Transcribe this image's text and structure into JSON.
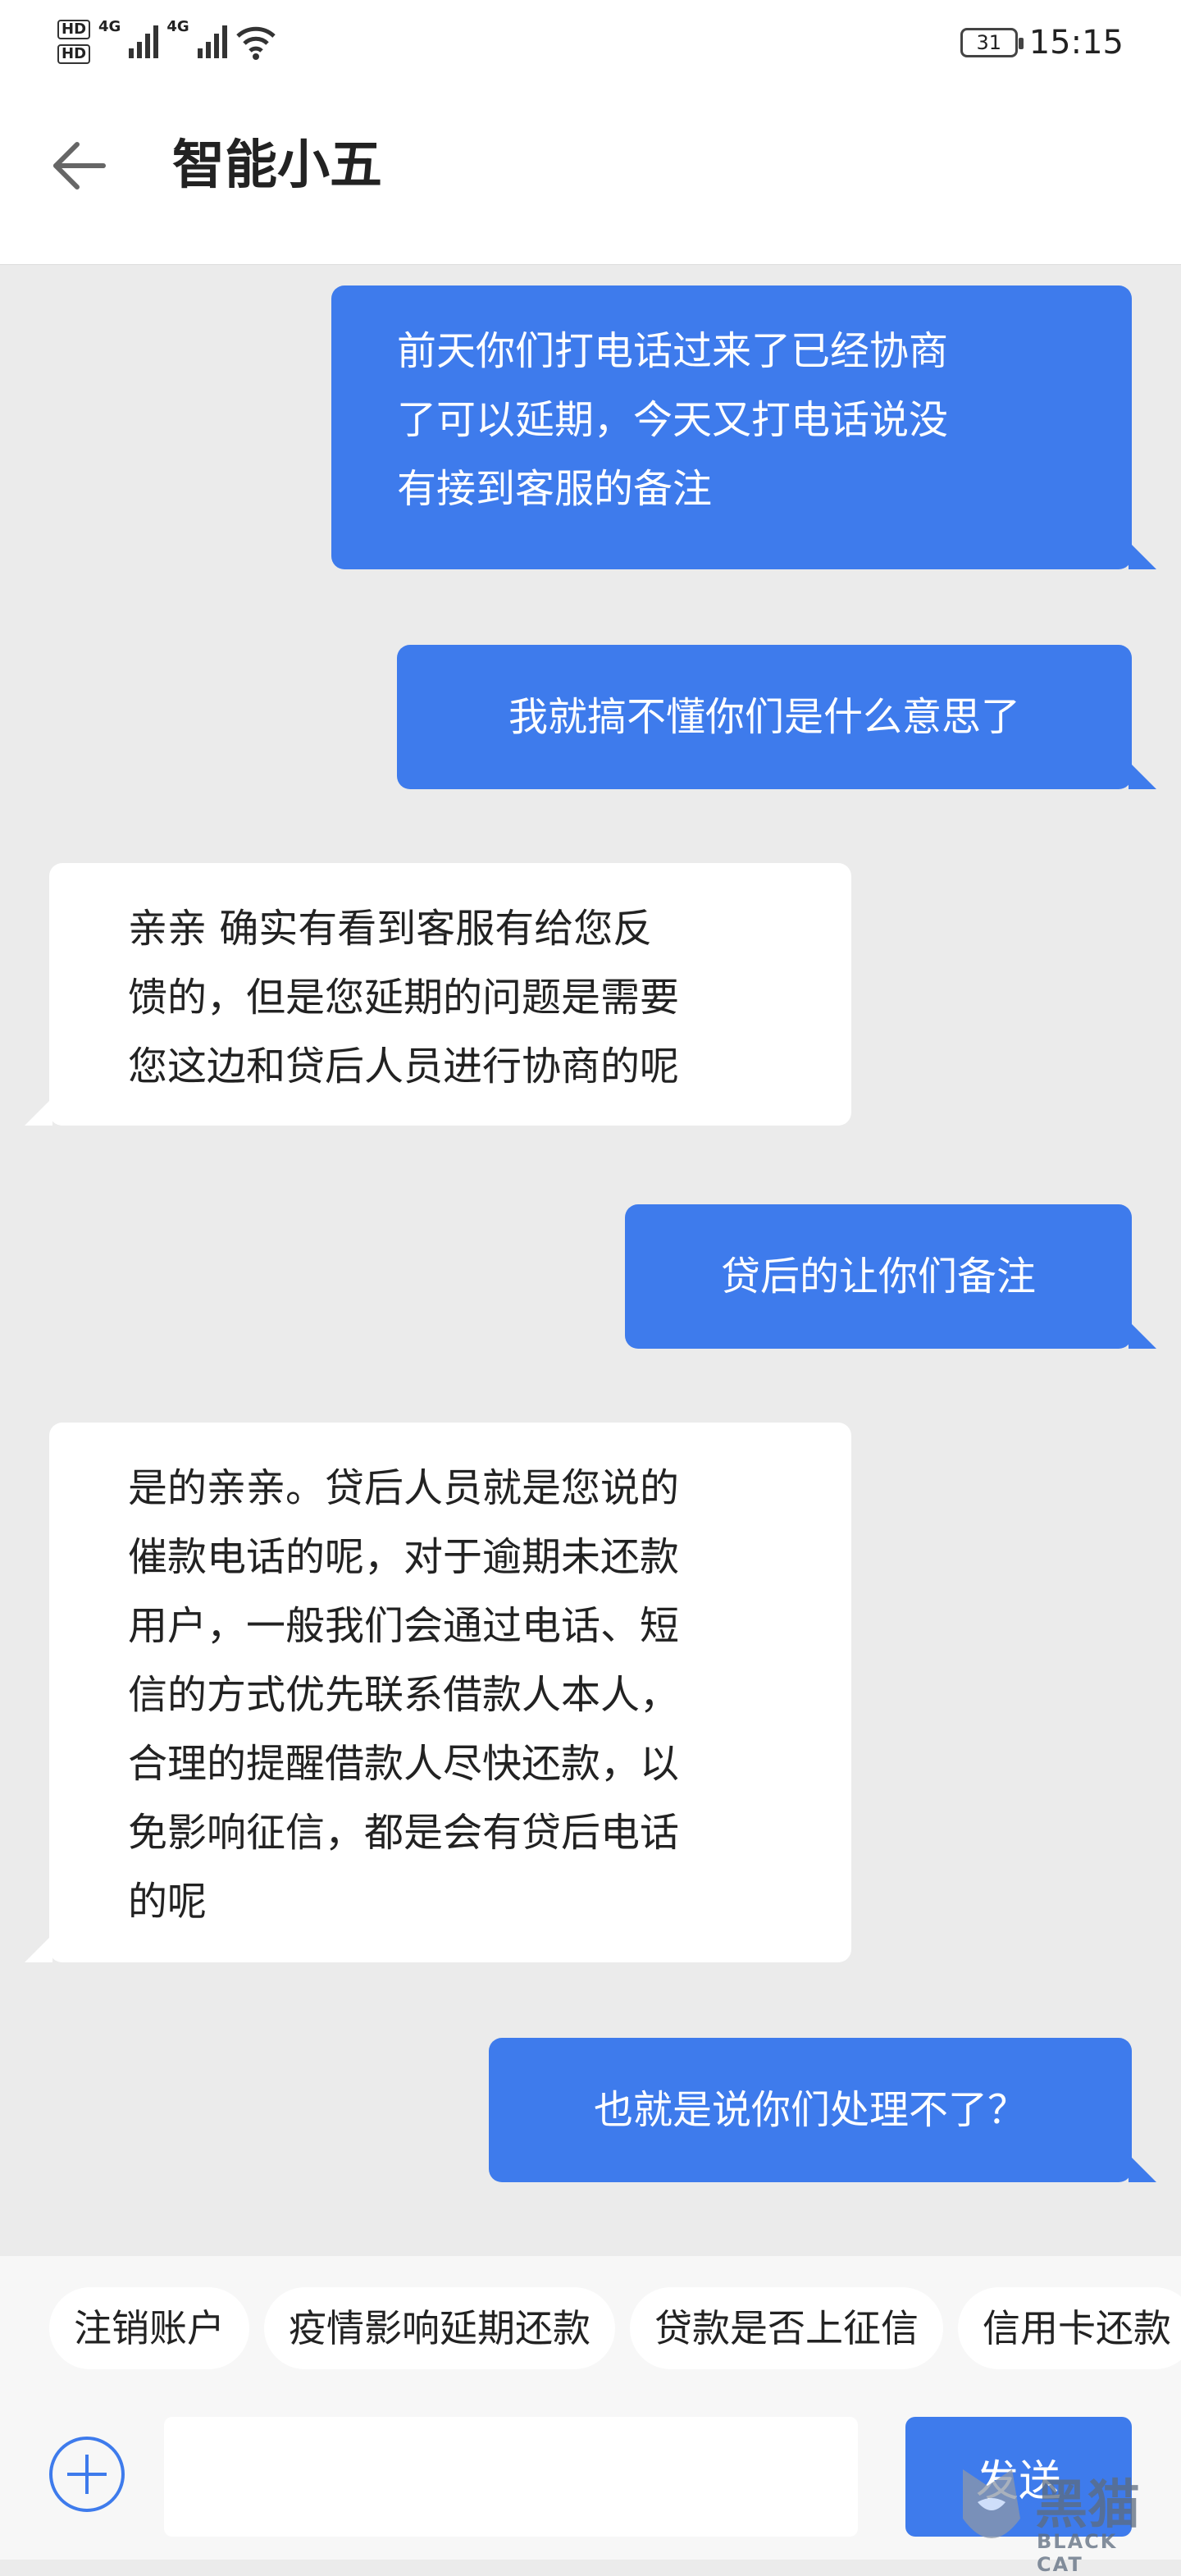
{
  "status_bar": {
    "hd1": "HD",
    "hd2": "HD",
    "net1": "4G",
    "net2": "4G",
    "battery": "31",
    "time": "15:15"
  },
  "header": {
    "title": "智能小五",
    "back_icon": "arrow-left-icon"
  },
  "messages": [
    {
      "side": "out",
      "lines": [
        "前天你们打电话过来了已经协商",
        "了可以延期，今天又打电话说没",
        "有接到客服的备注"
      ]
    },
    {
      "side": "out",
      "lines": [
        "我就搞不懂你们是什么意思了"
      ]
    },
    {
      "side": "in",
      "lines": [
        "亲亲  确实有看到客服有给您反",
        "馈的，但是您延期的问题是需要",
        "您这边和贷后人员进行协商的呢"
      ]
    },
    {
      "side": "out",
      "lines": [
        "贷后的让你们备注"
      ]
    },
    {
      "side": "in",
      "lines": [
        "是的亲亲。贷后人员就是您说的",
        "催款电话的呢，对于逾期未还款",
        "用户，一般我们会通过电话、短",
        "信的方式优先联系借款人本人，",
        "合理的提醒借款人尽快还款，以",
        "免影响征信，都是会有贷后电话",
        "的呢"
      ]
    },
    {
      "side": "out",
      "lines": [
        "也就是说你们处理不了？"
      ]
    }
  ],
  "quick_replies": [
    "注销账户",
    "疫情影响延期还款",
    "贷款是否上征信",
    "信用卡还款"
  ],
  "composer": {
    "input_value": "",
    "send_label": "发送",
    "add_icon": "plus-circle-icon"
  },
  "watermark": {
    "text": "黑猫",
    "subtext": "BLACK CAT"
  },
  "colors": {
    "accent": "#3e7bec",
    "chat_bg": "#ebebeb",
    "incoming_bg": "#ffffff"
  }
}
